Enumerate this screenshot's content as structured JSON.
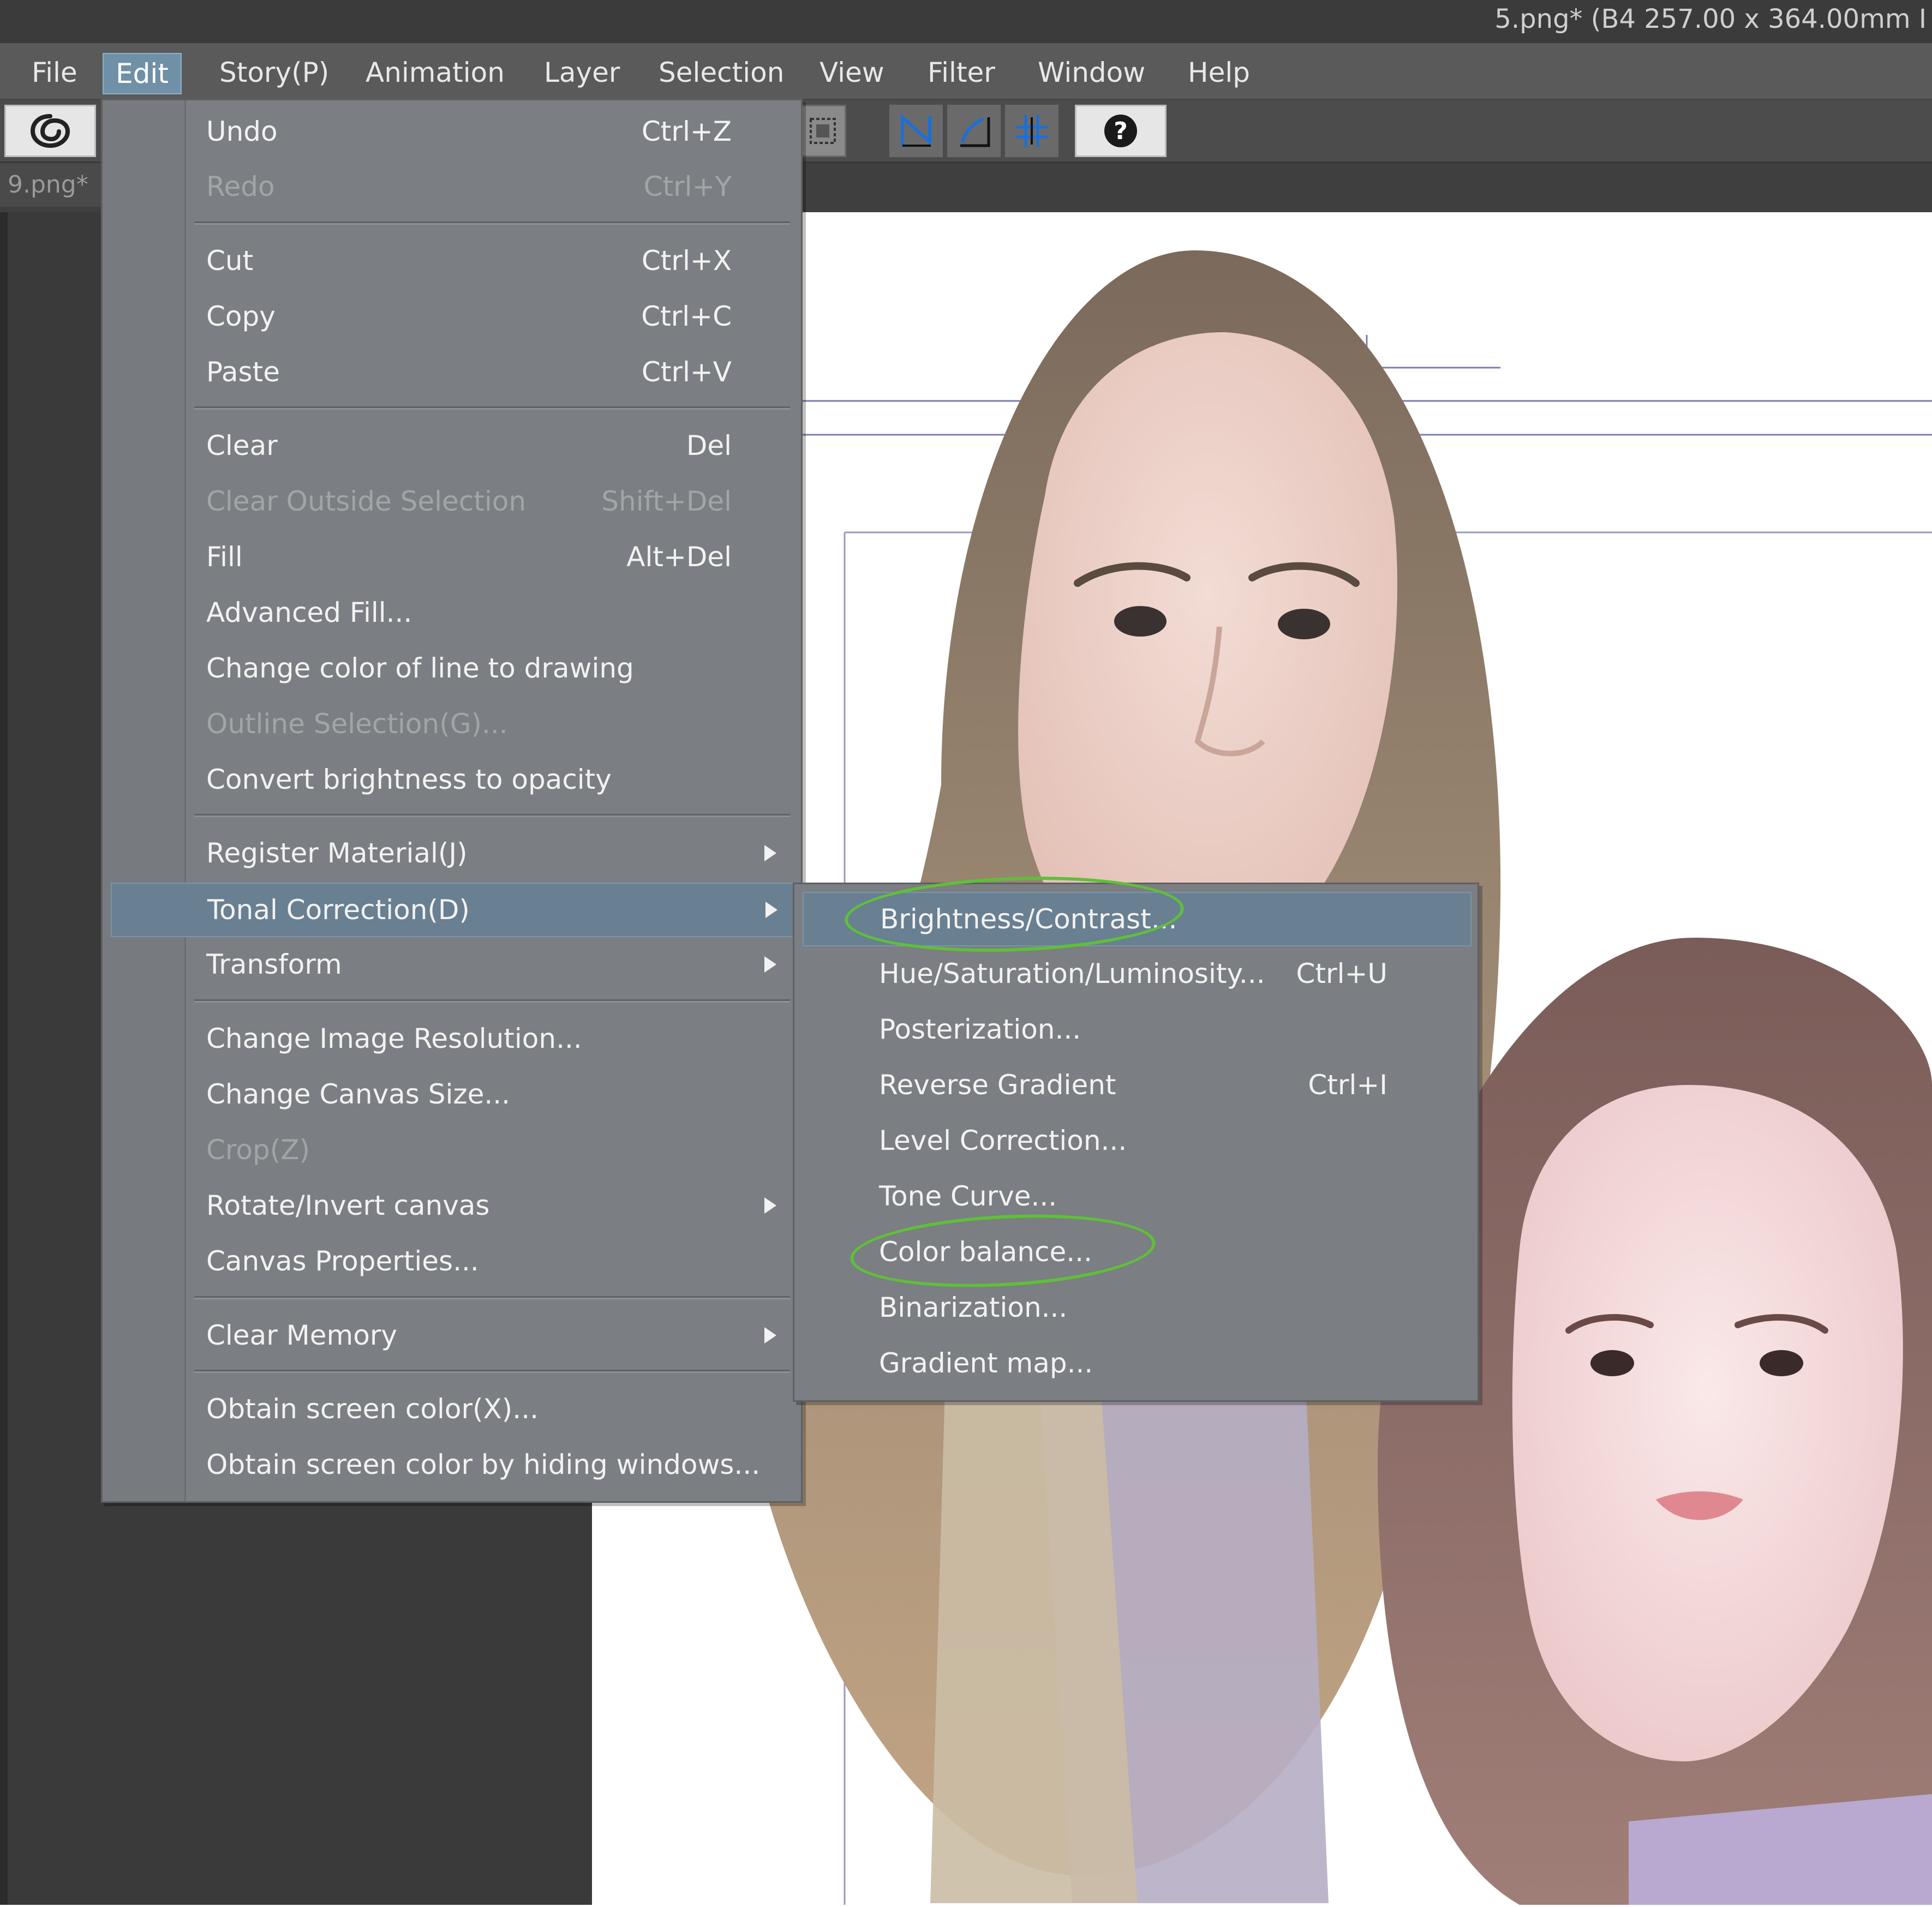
{
  "window": {
    "title": "5.png* (B4 257.00 x 364.00mm I"
  },
  "menubar": {
    "items": [
      "File",
      "Edit",
      "Story(P)",
      "Animation",
      "Layer",
      "Selection",
      "View",
      "Filter",
      "Window",
      "Help"
    ],
    "active": "Edit"
  },
  "tabs": {
    "document": "9.png*"
  },
  "edit_menu": {
    "items": [
      {
        "label": "Undo",
        "shortcut": "Ctrl+Z"
      },
      {
        "label": "Redo",
        "shortcut": "Ctrl+Y",
        "disabled": true
      },
      {
        "label": "Cut",
        "shortcut": "Ctrl+X"
      },
      {
        "label": "Copy",
        "shortcut": "Ctrl+C"
      },
      {
        "label": "Paste",
        "shortcut": "Ctrl+V"
      },
      {
        "label": "Clear",
        "shortcut": "Del"
      },
      {
        "label": "Clear Outside Selection",
        "shortcut": "Shift+Del",
        "disabled": true
      },
      {
        "label": "Fill",
        "shortcut": "Alt+Del"
      },
      {
        "label": "Advanced Fill..."
      },
      {
        "label": "Change color of line to drawing"
      },
      {
        "label": "Outline Selection(G)...",
        "disabled": true
      },
      {
        "label": "Convert brightness to opacity"
      },
      {
        "label": "Register Material(J)",
        "submenu": true
      },
      {
        "label": "Tonal Correction(D)",
        "submenu": true,
        "highlighted": true
      },
      {
        "label": "Transform",
        "submenu": true
      },
      {
        "label": "Change Image Resolution..."
      },
      {
        "label": "Change Canvas Size..."
      },
      {
        "label": "Crop(Z)",
        "disabled": true
      },
      {
        "label": "Rotate/Invert canvas",
        "submenu": true
      },
      {
        "label": "Canvas Properties..."
      },
      {
        "label": "Clear Memory",
        "submenu": true
      },
      {
        "label": "Obtain screen color(X)..."
      },
      {
        "label": "Obtain screen color by hiding windows..."
      }
    ]
  },
  "tonal_submenu": {
    "items": [
      {
        "label": "Brightness/Contrast...",
        "highlighted": true,
        "annotated": true
      },
      {
        "label": "Hue/Saturation/Luminosity...",
        "shortcut": "Ctrl+U"
      },
      {
        "label": "Posterization..."
      },
      {
        "label": "Reverse Gradient",
        "shortcut": "Ctrl+I"
      },
      {
        "label": "Level Correction..."
      },
      {
        "label": "Tone Curve..."
      },
      {
        "label": "Color balance...",
        "annotated": true
      },
      {
        "label": "Binarization..."
      },
      {
        "label": "Gradient map..."
      }
    ]
  },
  "colors": {
    "menu_bg": "#7b7e82",
    "menu_highlight": "#697f92",
    "annotation": "#5fbf3a",
    "active_menu": "#7090a8"
  },
  "icons": [
    "clip-studio-logo-icon",
    "selection-box-icon",
    "ruler-snap-icon",
    "special-ruler-snap-icon",
    "grid-snap-icon",
    "help-icon"
  ]
}
